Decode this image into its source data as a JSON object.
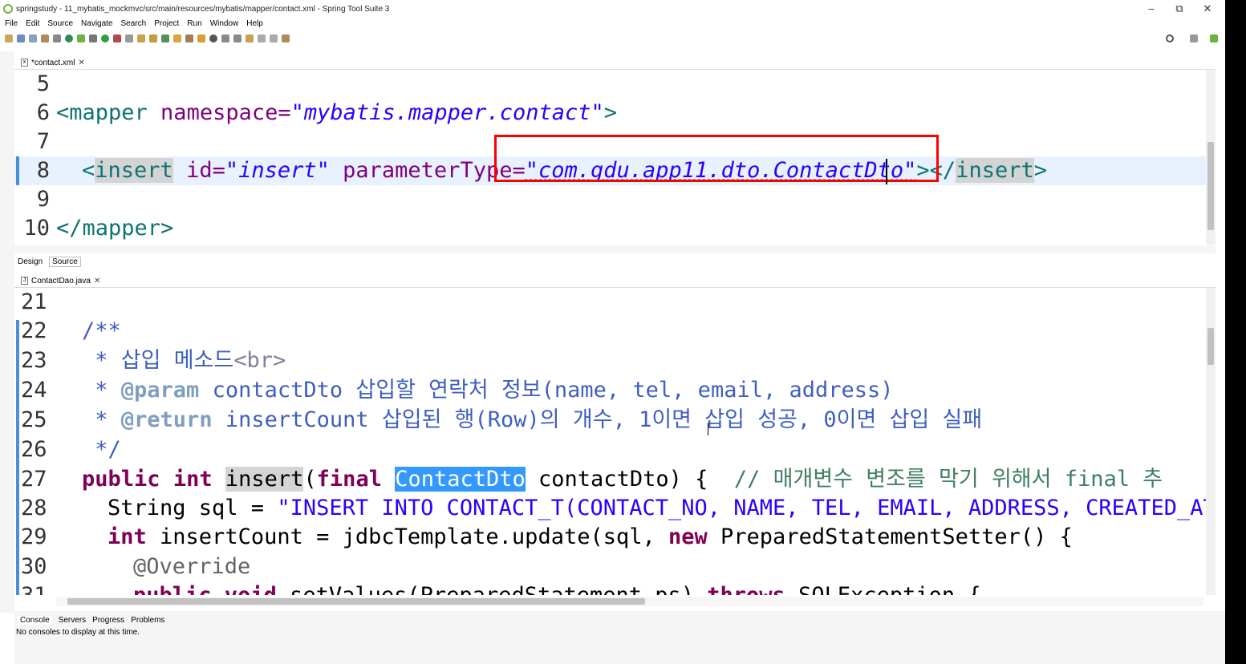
{
  "window": {
    "title": "springstudy - 11_mybatis_mockmvc/src/main/resources/mybatis/mapper/contact.xml - Spring Tool Suite 3",
    "minimize": "–",
    "maximize": "⧉",
    "close": "✕"
  },
  "menu": [
    "File",
    "Edit",
    "Source",
    "Navigate",
    "Search",
    "Project",
    "Run",
    "Window",
    "Help"
  ],
  "xml_editor": {
    "tab_label": "*contact.xml",
    "lines": [
      {
        "n": "5"
      },
      {
        "n": "6"
      },
      {
        "n": "7"
      },
      {
        "n": "8"
      },
      {
        "n": "9"
      },
      {
        "n": "10"
      }
    ],
    "mapper_tag_open": "<mapper",
    "namespace_attr": " namespace=",
    "namespace_value": "\"mybatis.mapper.contact\"",
    "mapper_gt": ">",
    "insert_open": "<",
    "insert_name": "insert",
    "id_attr": " id=",
    "id_value": "\"insert\"",
    "param_attr": " parameterType=",
    "param_value": "\"com.gdu.app11.dto.ContactDto\"",
    "insert_gt": ">",
    "insert_close_lt": "</",
    "insert_close_name": "insert",
    "insert_close_gt": ">",
    "mapper_close": "</mapper>",
    "bottom_tabs": [
      "Design",
      "Source"
    ]
  },
  "java_editor": {
    "tab_label": "ContactDao.java",
    "line_numbers": [
      "21",
      "22",
      "23",
      "24",
      "25",
      "26",
      "27",
      "28",
      "29",
      "30",
      "31"
    ],
    "l22": "/**",
    "l23_star": " * ",
    "l23_text": "삽입 메소드",
    "l23_br": "<br>",
    "l24_star": " * ",
    "l24_tag": "@param",
    "l24_text": " contactDto 삽입할 연락처 정보(name, tel, email, address)",
    "l25_star": " * ",
    "l25_tag": "@return",
    "l25_text": " insertCount 삽입된 행(Row)의 개수, 1이면 삽입 성공, 0이면 삽입 실패",
    "l26": " */",
    "l27_public": "public",
    "l27_int": "int",
    "l27_insert": "insert",
    "l27_paren": "(",
    "l27_final": "final",
    "l27_type": "ContactDto",
    "l27_rest": " contactDto) {  ",
    "l27_comment": "// 매개변수 변조를 막기 위해서 final 추",
    "l28_type": "String sql = ",
    "l28_str": "\"INSERT INTO CONTACT_T(CONTACT_NO, NAME, TEL, EMAIL, ADDRESS, CREATED_AT)",
    "l29_int": "int",
    "l29_mid": " insertCount = jdbcTemplate.update(sql, ",
    "l29_new": "new",
    "l29_rest": " PreparedStatementSetter() {",
    "l30": "@Override",
    "l31_public": "public",
    "l31_void": "void",
    "l31_mid": " setValues(PreparedStatement ps) ",
    "l31_throws": "throws",
    "l31_rest": " SQLException {"
  },
  "console": {
    "tabs": [
      "Console",
      "Servers",
      "Progress",
      "Problems"
    ],
    "message": "No consoles to display at this time."
  },
  "colors": {
    "highlight_box": "#ff0000",
    "selection": "#3399ff",
    "xml_tag": "#0e7373",
    "xml_attr": "#7f007f",
    "xml_value": "#2a00ff",
    "java_keyword": "#7f0055",
    "comment": "#3f7f5f"
  }
}
